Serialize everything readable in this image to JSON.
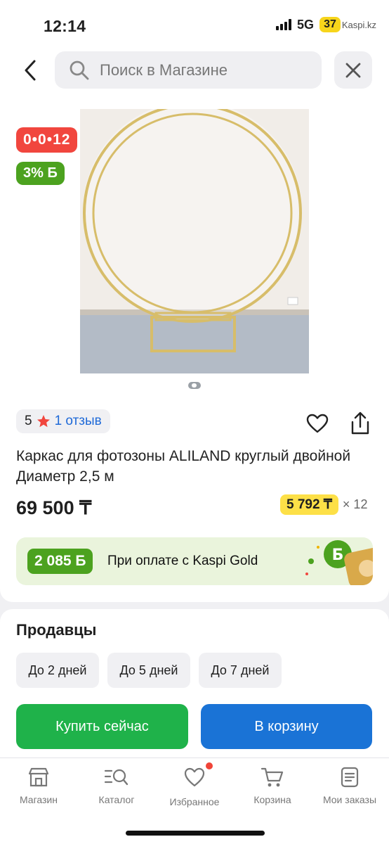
{
  "status_bar": {
    "time": "12:14",
    "network": "5G",
    "battery": "37",
    "watermark": "Kaspi.kz"
  },
  "search": {
    "placeholder": "Поиск в Магазине"
  },
  "product": {
    "timer": "0•0•12",
    "cashback_badge": "3% Б",
    "rating_value": "5",
    "reviews": "1 отзыв",
    "title": "Каркас для фотозоны ALILAND круглый двойной Диаметр 2,5 м",
    "price": "69 500 ₸",
    "installment": "5 792 ₸",
    "installment_months": "× 12",
    "kaspi_gold": {
      "bonus": "2 085 Б",
      "text": "При оплате с Kaspi Gold"
    }
  },
  "sellers": {
    "title": "Продавцы",
    "filters": [
      "До 2 дней",
      "До 5 дней",
      "До 7 дней"
    ]
  },
  "actions": {
    "buy_now": "Купить сейчас",
    "to_cart": "В корзину"
  },
  "nav": {
    "items": [
      "Магазин",
      "Каталог",
      "Избранное",
      "Корзина",
      "Мои заказы"
    ]
  },
  "colors": {
    "green": "#1fb24a",
    "blue": "#1a73d6",
    "red_badge": "#f1463e",
    "bonus_green": "#4ca21f",
    "installment_yellow": "#fde047",
    "notification_dot": "#f04438"
  }
}
